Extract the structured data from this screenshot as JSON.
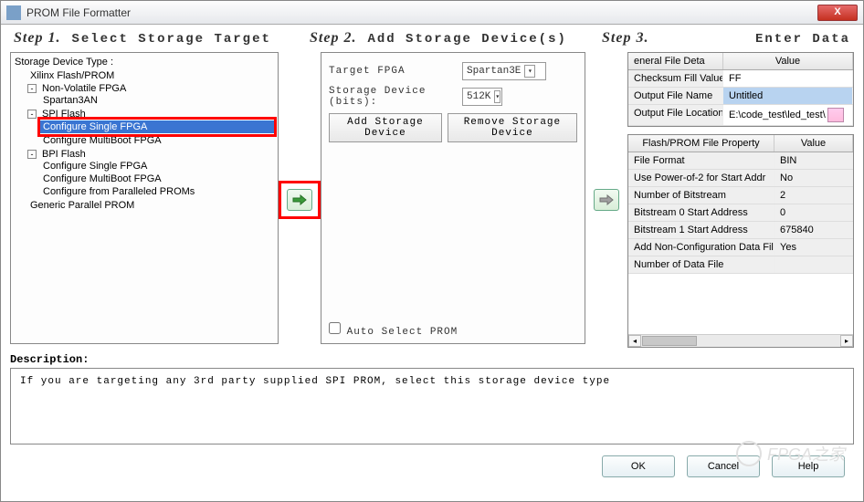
{
  "window": {
    "title": "PROM File Formatter"
  },
  "steps": {
    "step1_label": "Step 1.",
    "step1_title": "Select Storage Target",
    "step2_label": "Step 2.",
    "step2_title": "Add Storage Device(s)",
    "step3_label": "Step 3.",
    "step3_title": "Enter Data"
  },
  "tree": {
    "header": "Storage Device Type :",
    "items": {
      "xilinx": "Xilinx Flash/PROM",
      "nonvol": "Non-Volatile FPGA",
      "spartan": "Spartan3AN",
      "spi": "SPI Flash",
      "spi_single": "Configure Single FPGA",
      "spi_multi": "Configure MultiBoot FPGA",
      "bpi": "BPI Flash",
      "bpi_single": "Configure Single FPGA",
      "bpi_multi": "Configure MultiBoot FPGA",
      "bpi_prom": "Configure from Paralleled PROMs",
      "generic": "Generic Parallel PROM"
    }
  },
  "mid": {
    "target_label": "Target FPGA",
    "target_value": "Spartan3E",
    "storage_label": "Storage Device (bits):",
    "storage_value": "512K",
    "add_btn": "Add Storage Device",
    "remove_btn": "Remove Storage Device",
    "auto_label": "Auto Select PROM"
  },
  "general": {
    "col1": "eneral File Deta",
    "col2": "Value",
    "rows": [
      {
        "k": "Checksum Fill Value",
        "v": "FF"
      },
      {
        "k": "Output File Name",
        "v": "Untitled",
        "sel": true
      },
      {
        "k": "Output File Location",
        "v": "E:\\code_test\\led_test\\",
        "folder": true
      }
    ]
  },
  "props": {
    "col1": "Flash/PROM File Property",
    "col2": "Value",
    "rows": [
      {
        "k": "File Format",
        "v": "BIN"
      },
      {
        "k": "Use Power-of-2 for Start Addr",
        "v": "No"
      },
      {
        "k": "Number of Bitstream",
        "v": "2"
      },
      {
        "k": "Bitstream 0 Start Address",
        "v": "0"
      },
      {
        "k": "Bitstream 1 Start Address",
        "v": "675840"
      },
      {
        "k": "Add Non-Configuration Data Files",
        "v": "Yes"
      },
      {
        "k": "Number of Data File",
        "v": ""
      }
    ]
  },
  "description": {
    "header": "Description:",
    "text": "If you are targeting any 3rd party supplied SPI PROM, select this storage device type"
  },
  "buttons": {
    "ok": "OK",
    "cancel": "Cancel",
    "help": "Help"
  },
  "watermark": "FPGA之家"
}
